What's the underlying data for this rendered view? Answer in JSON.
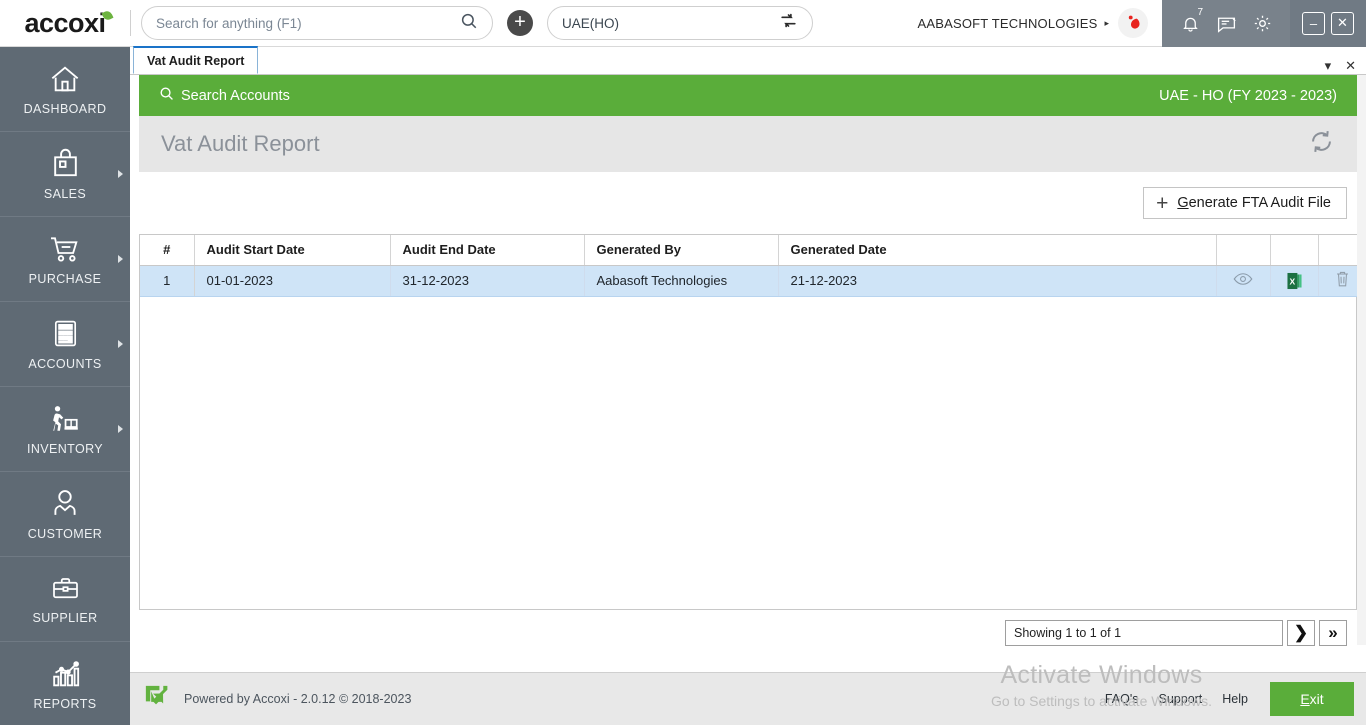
{
  "app": {
    "logo_text": "accoxi",
    "logo_leaf": "leaf-accent"
  },
  "topbar": {
    "search": {
      "placeholder": "Search for anything (F1)",
      "value": "",
      "icon": "search-icon"
    },
    "add_button_label": "+",
    "branch": {
      "value": "UAE(HO)",
      "switch_icon": "switch-branch-icon"
    },
    "company_name": "AABASOFT TECHNOLOGIES",
    "company_caret": "▸",
    "avatar": "user-avatar",
    "icons": {
      "notification": "bell-icon",
      "notification_count": "7",
      "messages": "message-icon",
      "settings": "gear-icon"
    },
    "window": {
      "minimize": "–",
      "close": "✕"
    }
  },
  "sidebar": {
    "items": [
      {
        "label": "DASHBOARD",
        "icon": "home-icon",
        "has_arrow": false
      },
      {
        "label": "SALES",
        "icon": "shopping-bag-icon",
        "has_arrow": true
      },
      {
        "label": "PURCHASE",
        "icon": "shopping-cart-icon",
        "has_arrow": true
      },
      {
        "label": "ACCOUNTS",
        "icon": "calculator-icon",
        "has_arrow": true
      },
      {
        "label": "INVENTORY",
        "icon": "warehouse-worker-icon",
        "has_arrow": true
      },
      {
        "label": "CUSTOMER",
        "icon": "person-icon",
        "has_arrow": false
      },
      {
        "label": "SUPPLIER",
        "icon": "briefcase-icon",
        "has_arrow": false
      },
      {
        "label": "REPORTS",
        "icon": "bar-chart-icon",
        "has_arrow": false
      }
    ]
  },
  "tabstrip": {
    "tabs": [
      {
        "label": "Vat Audit Report",
        "active": true
      }
    ],
    "dropdown_icon": "▾",
    "close_icon": "✕"
  },
  "greenbar": {
    "search_accounts_label": "Search Accounts",
    "search_icon": "search-icon",
    "fiscal_year": "UAE - HO (FY 2023 - 2023)",
    "color": "#5aad3a"
  },
  "pagehead": {
    "title": "Vat Audit Report",
    "refresh_icon": "refresh-icon"
  },
  "actionbar": {
    "generate_button": {
      "plus": "+",
      "accel": "G",
      "rest": "enerate FTA Audit File"
    }
  },
  "table": {
    "columns": [
      "#",
      "Audit Start Date",
      "Audit End Date",
      "Generated By",
      "Generated Date",
      "",
      "",
      ""
    ],
    "rows": [
      {
        "index": "1",
        "audit_start_date": "01-01-2023",
        "audit_end_date": "31-12-2023",
        "generated_by": "Aabasoft Technologies",
        "generated_date": "21-12-2023",
        "view_icon": "eye-icon",
        "excel_icon": "excel-export-icon",
        "delete_icon": "trash-icon"
      }
    ]
  },
  "pagination": {
    "status_text": "Showing 1 to 1 of 1",
    "next_icon": "❯",
    "last_icon": "»"
  },
  "footer": {
    "logo": "accoxi-mark-icon",
    "powered_by": "Powered by Accoxi - 2.0.12 © 2018-2023",
    "links": [
      "FAQ's",
      "Support",
      "Help"
    ],
    "exit": {
      "accel": "E",
      "rest": "xit"
    }
  },
  "watermark": {
    "line1": "Activate Windows",
    "line2": "Go to Settings to activate Windows."
  }
}
